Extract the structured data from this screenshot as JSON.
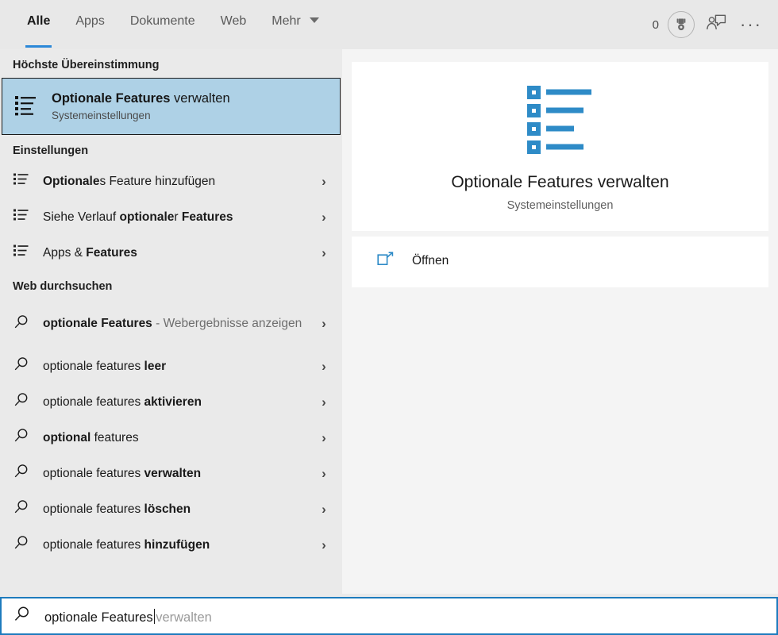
{
  "tabs": [
    {
      "label": "Alle",
      "active": true
    },
    {
      "label": "Apps",
      "active": false
    },
    {
      "label": "Dokumente",
      "active": false
    },
    {
      "label": "Web",
      "active": false
    },
    {
      "label": "Mehr",
      "active": false,
      "has_caret": true
    }
  ],
  "header": {
    "reward_count": "0",
    "medal_icon": "medal-icon",
    "feedback_icon": "feedback-person-icon",
    "more_icon": "ellipsis-icon"
  },
  "groups": {
    "best_match_heading": "Höchste Übereinstimmung",
    "settings_heading": "Einstellungen",
    "web_heading": "Web durchsuchen"
  },
  "best_match": {
    "title_bold": "Optionale Features",
    "title_rest": " verwalten",
    "subtitle": "Systemeinstellungen",
    "icon": "list-settings-icon"
  },
  "settings_results": [
    {
      "pre": "",
      "bold": "Optionale",
      "post": "s Feature hinzufügen",
      "icon": "list-settings-icon",
      "chevron": "›"
    },
    {
      "pre": "Siehe Verlauf ",
      "bold": "optionale",
      "post": "r ",
      "bold2": "Features",
      "icon": "list-settings-icon",
      "chevron": "›"
    },
    {
      "pre": "Apps & ",
      "bold": "Features",
      "post": "",
      "icon": "list-settings-icon",
      "chevron": "›"
    }
  ],
  "web_results": [
    {
      "pre": "",
      "bold": "optionale Features",
      "muted": " - Webergebnisse anzeigen",
      "icon": "search-icon",
      "chevron": "›",
      "tall": true
    },
    {
      "pre": "optionale features ",
      "bold": "leer",
      "icon": "search-icon",
      "chevron": "›"
    },
    {
      "pre": "optionale features ",
      "bold": "aktivieren",
      "icon": "search-icon",
      "chevron": "›"
    },
    {
      "pre": "",
      "bold": "optional",
      "post": " features",
      "icon": "search-icon",
      "chevron": "›"
    },
    {
      "pre": "optionale features ",
      "bold": "verwalten",
      "icon": "search-icon",
      "chevron": "›"
    },
    {
      "pre": "optionale features ",
      "bold": "löschen",
      "icon": "search-icon",
      "chevron": "›"
    },
    {
      "pre": "optionale features ",
      "bold": "hinzufügen",
      "icon": "search-icon",
      "chevron": "›"
    }
  ],
  "preview": {
    "title": "Optionale Features verwalten",
    "subtitle": "Systemeinstellungen",
    "icon": "list-settings-icon-large",
    "actions": [
      {
        "label": "Öffnen",
        "icon": "open-external-icon"
      }
    ]
  },
  "search": {
    "icon": "search-icon",
    "typed": "optionale Features",
    "suggestion": "verwalten"
  },
  "colors": {
    "accent": "#2b88d8",
    "selection_bg": "#aed1e6",
    "panel_bg": "#eaeaea",
    "preview_bg": "#f4f4f4",
    "card_bg": "#ffffff",
    "icon_blue": "#2e8bc7",
    "search_border": "#1e7bbd"
  }
}
